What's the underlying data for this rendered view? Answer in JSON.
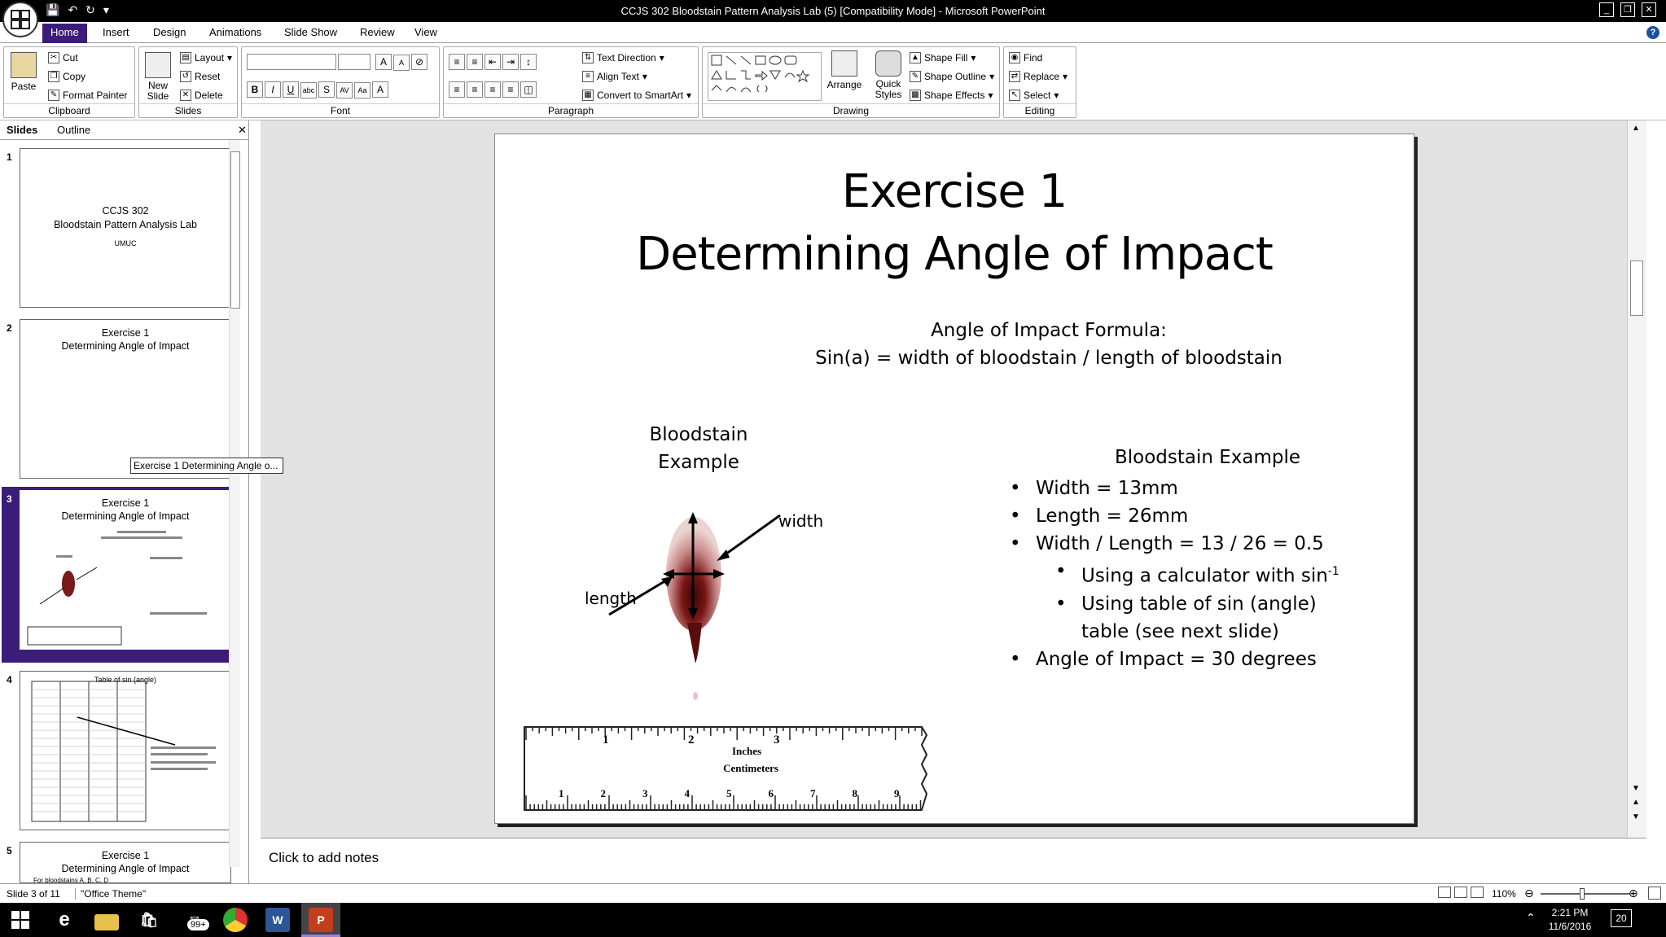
{
  "app": {
    "title": "CCJS 302 Bloodstain Pattern Analysis Lab (5) [Compatibility Mode] - Microsoft PowerPoint",
    "tabs": [
      "Home",
      "Insert",
      "Design",
      "Animations",
      "Slide Show",
      "Review",
      "View"
    ],
    "active_tab": "Home",
    "accent": "#3b1d79"
  },
  "ribbon": {
    "clipboard": {
      "paste": "Paste",
      "cut": "Cut",
      "copy": "Copy",
      "format_painter": "Format Painter",
      "label": "Clipboard"
    },
    "slides": {
      "new_slide": "New Slide",
      "layout": "Layout",
      "reset": "Reset",
      "delete": "Delete",
      "label": "Slides"
    },
    "font": {
      "label": "Font"
    },
    "paragraph": {
      "text_direction": "Text Direction",
      "align_text": "Align Text",
      "convert": "Convert to SmartArt",
      "label": "Paragraph"
    },
    "drawing": {
      "arrange": "Arrange",
      "quick_styles": "Quick Styles",
      "shape_fill": "Shape Fill",
      "shape_outline": "Shape Outline",
      "shape_effects": "Shape Effects",
      "label": "Drawing"
    },
    "editing": {
      "find": "Find",
      "replace": "Replace",
      "select": "Select",
      "label": "Editing"
    }
  },
  "panel": {
    "tab_slides": "Slides",
    "tab_outline": "Outline",
    "thumbs": [
      {
        "num": "1",
        "line1": "CCJS 302",
        "line2": "Bloodstain Pattern Analysis Lab",
        "line3": "UMUC"
      },
      {
        "num": "2",
        "line1": "Exercise 1",
        "line2": "Determining Angle of Impact"
      },
      {
        "num": "3",
        "line1": "Exercise 1",
        "line2": "Determining Angle of Impact"
      },
      {
        "num": "4",
        "line1": "Table of sin (angle)"
      },
      {
        "num": "5",
        "line1": "Exercise 1",
        "line2": "Determining Angle of Impact",
        "line3": "For bloodstains A, B, C, D"
      }
    ],
    "tooltip": "Exercise 1 Determining Angle o..."
  },
  "slide": {
    "title1": "Exercise 1",
    "title2": "Determining Angle of Impact",
    "formula1": "Angle of Impact Formula:",
    "formula2": "Sin(a) = width of bloodstain / length of bloodstain",
    "bloodstain_label1": "Bloodstain",
    "bloodstain_label2": "Example",
    "width_label": "width",
    "length_label": "length",
    "right_heading": "Bloodstain Example",
    "b1": "Width = 13mm",
    "b2": "Length = 26mm",
    "b3": "Width / Length = 13 / 26 = 0.5",
    "b4": "Using a calculator with sin",
    "b4_sup": "-1",
    "b5a": "Using table of sin (angle)",
    "b5b": "table (see next slide)",
    "b6": "Angle of Impact = 30 degrees",
    "ruler_inches": "Inches",
    "ruler_cm": "Centimeters"
  },
  "notes": {
    "placeholder": "Click to add notes"
  },
  "status": {
    "slide": "Slide 3 of 11",
    "theme": "\"Office Theme\"",
    "zoom": "110%"
  },
  "taskbar": {
    "time": "2:21 PM",
    "date": "11/6/2016",
    "badge": "99+",
    "notif": "20"
  }
}
